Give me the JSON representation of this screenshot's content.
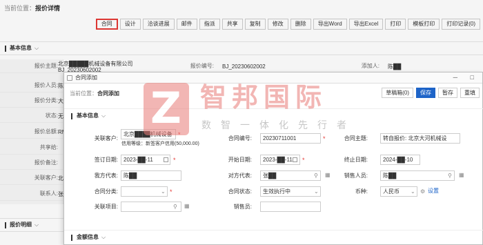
{
  "breadcrumb": {
    "prefix": "当前位置：",
    "current": "报价详情"
  },
  "toolbar": [
    "合同",
    "设计",
    "洽谈进展",
    "邮件",
    "指派",
    "共享",
    "复制",
    "修改",
    "删除",
    "导出Word",
    "导出Excel",
    "打印",
    "模板打印",
    "打印记录(0)"
  ],
  "bg": {
    "section1": "基本信息",
    "section2": "报价明细",
    "rows": [
      {
        "label": "报价主题:",
        "value": "北京█████机械设备有限公司BJ_20230602002"
      },
      {
        "label": "报价人员:",
        "value": "陈"
      },
      {
        "label": "报价分类:",
        "value": "大"
      },
      {
        "label": "状态:",
        "value": "无"
      },
      {
        "label": "报价总额:",
        "value": "RM"
      },
      {
        "label": "共享给:",
        "value": ""
      },
      {
        "label": "报价备注:",
        "value": ""
      },
      {
        "label": "关联客户:",
        "value": "北"
      },
      {
        "label": "联系人:",
        "value": "张"
      }
    ],
    "quote_no_label": "报价编号:",
    "quote_no_value": "BJ_20230602002",
    "adder_label": "添加人:",
    "adder_value": "陈██"
  },
  "modal": {
    "window_title": "合同添加",
    "window_controls": "─ □",
    "breadcrumb_prefix": "当前位置：",
    "breadcrumb_current": "合同添加",
    "buttons": {
      "draft_box": "草稿箱(0)",
      "save": "保存",
      "hold": "暂存",
      "reset": "重填"
    },
    "section_basic": "基本信息",
    "section_amount": "金额信息",
    "fields": {
      "customer": {
        "label": "关联客户:",
        "value": "北京████机械设备"
      },
      "credit_text": "信用等级：新签客户信用(50,000.00)",
      "contract_no": {
        "label": "合同编号:",
        "value": "20230711001"
      },
      "contract_subject": {
        "label": "合同主题:",
        "value": "转自报价: 北京大河机械设"
      },
      "sign_date": {
        "label": "签订日期:",
        "value": "2023-██-11"
      },
      "start_date": {
        "label": "开始日期:",
        "value": "2023-██-11"
      },
      "end_date": {
        "label": "终止日期:",
        "value": "2024-██-10"
      },
      "our_rep": {
        "label": "我方代表:",
        "value": "陈██"
      },
      "their_rep": {
        "label": "对方代表:",
        "value": "张██"
      },
      "sales": {
        "label": "销售人员:",
        "value": "陈██"
      },
      "contract_type": {
        "label": "合同分类:",
        "value": ""
      },
      "contract_status": {
        "label": "合同状态:",
        "value": "生效执行中"
      },
      "currency": {
        "label": "币种:",
        "value": "人民币"
      },
      "currency_link": "设置",
      "project": {
        "label": "关联项目:",
        "value": ""
      },
      "salesperson2": {
        "label": "销售员:",
        "value": ""
      }
    }
  },
  "watermark": {
    "logo_letter": "Z",
    "title": "智邦国际",
    "slogan": "数智一体化先行者"
  },
  "colors": {
    "primary": "#1e64c8",
    "highlight": "#e53935",
    "watermark": "#e97b77"
  }
}
